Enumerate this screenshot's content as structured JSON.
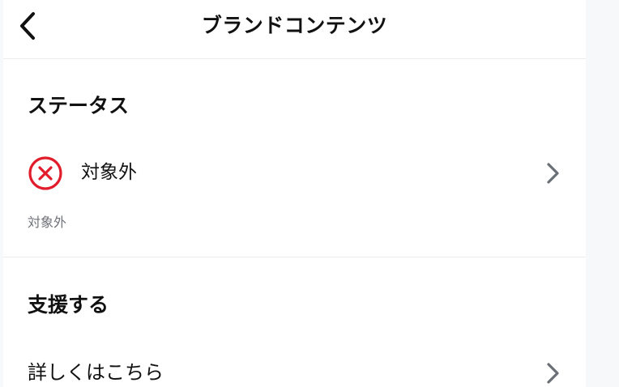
{
  "header": {
    "title": "ブランドコンテンツ",
    "back_icon": "chevron-left-icon"
  },
  "status_section": {
    "heading": "ステータス",
    "status": {
      "icon": "x-circle-icon",
      "icon_color": "#e11d2b",
      "label": "対象外",
      "chevron_icon": "chevron-right-icon"
    },
    "description": "対象外"
  },
  "support_section": {
    "heading": "支援する",
    "link": {
      "label": "詳しくはこちら",
      "chevron_icon": "chevron-right-icon"
    }
  },
  "colors": {
    "text": "#111111",
    "secondary_text": "#6f7178",
    "divider": "#ececec",
    "chevron": "#6b6f76",
    "background": "#f7f8fa"
  }
}
